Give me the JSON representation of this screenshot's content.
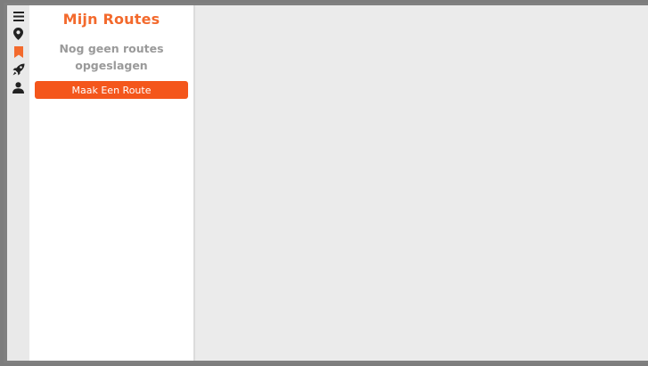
{
  "sidebar": {
    "icons": [
      {
        "name": "menu-icon"
      },
      {
        "name": "location-pin-icon"
      },
      {
        "name": "bookmark-icon",
        "active": true,
        "color": "#f36a2d"
      },
      {
        "name": "rocket-icon"
      },
      {
        "name": "user-icon"
      }
    ]
  },
  "panel": {
    "title": "Mijn Routes",
    "empty_message": "Nog geen routes opgeslagen",
    "create_button_label": "Maak Een Route"
  },
  "colors": {
    "accent": "#f36a2d",
    "button": "#f4561b",
    "icon": "#222222"
  }
}
